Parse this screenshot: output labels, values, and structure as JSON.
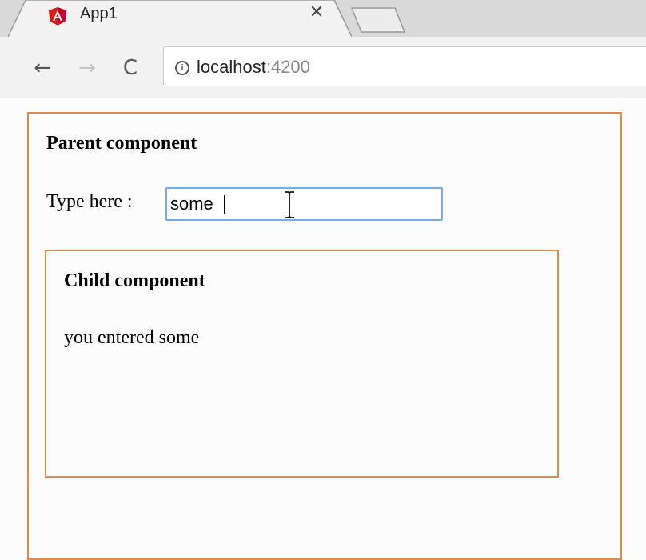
{
  "browser": {
    "tab": {
      "title": "App1",
      "favicon": "angular-logo-icon",
      "close_label": "✕"
    },
    "toolbar": {
      "back_icon": "back-arrow-icon",
      "forward_icon": "forward-arrow-icon",
      "reload_icon": "reload-icon",
      "back_glyph": "←",
      "forward_glyph": "→",
      "reload_glyph": "C",
      "info_glyph": "i"
    },
    "address_bar": {
      "host": "localhost",
      "port": ":4200"
    }
  },
  "page": {
    "parent": {
      "title": "Parent component",
      "input_label": "Type here :",
      "input_value": "some"
    },
    "child": {
      "title": "Child component",
      "message": "you entered some"
    }
  },
  "colors": {
    "component_border": "#e08a4b",
    "input_focus_border": "#7aa7e6",
    "angular_red": "#dd1b16"
  }
}
